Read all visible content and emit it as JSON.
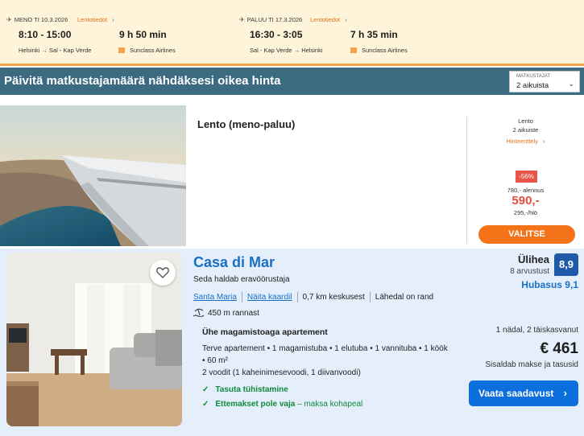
{
  "flight_header": {
    "outbound": {
      "title": "MENO TI 10.3.2026",
      "link": "Lentotiedot",
      "time": "8:10 - 15:00",
      "duration": "9 h 50 min",
      "route": "Helsinki → Sal - Kap Verde",
      "airline": "Sunclass Airlines"
    },
    "return": {
      "title": "PALUU TI 17.3.2026",
      "link": "Lentotiedot",
      "time": "16:30 - 3:05",
      "duration": "7 h 35 min",
      "route": "Sal - Kap Verde → Helsinki",
      "airline": "Sunclass Airlines"
    }
  },
  "banner": {
    "text": "Päivitä matkustajamäärä nähdäksesi oikea hinta",
    "passengers_label": "MATKUSTAJAT",
    "passengers_value": "2 aikuista"
  },
  "flight_card": {
    "label": "Lento (meno-paluu)",
    "summary_title": "Lento",
    "summary_pax": "2 aikuiste",
    "price_breakdown_link": "Hinteerittely",
    "discount_badge": "-56%",
    "discount_text": "780,- alennus",
    "price": "590,-",
    "price_per_person": "295,-/hlö",
    "select_button": "VALITSE"
  },
  "hotel_card": {
    "name": "Casa di Mar",
    "operator": "Seda haldab eravöörustaja",
    "area_link": "Santa Maria",
    "map_link": "Näita kaardil",
    "center_distance": "0,7 km keskusest",
    "beach_note": "Lähedal on rand",
    "beach_distance": "450 m rannast",
    "room_title": "Ühe magamistoaga apartement",
    "room_desc": "Terve apartement • 1 magamistuba • 1 elutuba • 1 vannituba • 1 köök • 60 m²",
    "room_beds": "2 voodit (1 kaheinimesevoodi, 1 diivanvoodi)",
    "perk_cancel": "Tasuta tühistamine",
    "perk_prepay": "Ettemakset pole vaja",
    "perk_prepay_note": " – maksa kohapeal",
    "rating_word": "Ülihea",
    "rating_count": "8 arvustust",
    "rating_score": "8,9",
    "location_score": "Hubasus 9,1",
    "stay_info": "1 nädal, 2 täiskasvanut",
    "price": "€ 461",
    "tax_info": "Sisaldab makse ja tasusid",
    "cta": "Vaata saadavust"
  },
  "colors": {
    "accent_orange": "#f47319",
    "banner_teal": "#3a6b80",
    "hotel_bg": "#e4effb",
    "link_blue": "#1a6fc4",
    "rating_blue": "#1f5aa8",
    "discount_red": "#e85548"
  },
  "icons": [
    "plane-icon",
    "chevron-right-icon",
    "chevron-down-icon",
    "heart-icon",
    "beach-icon",
    "check-icon"
  ]
}
